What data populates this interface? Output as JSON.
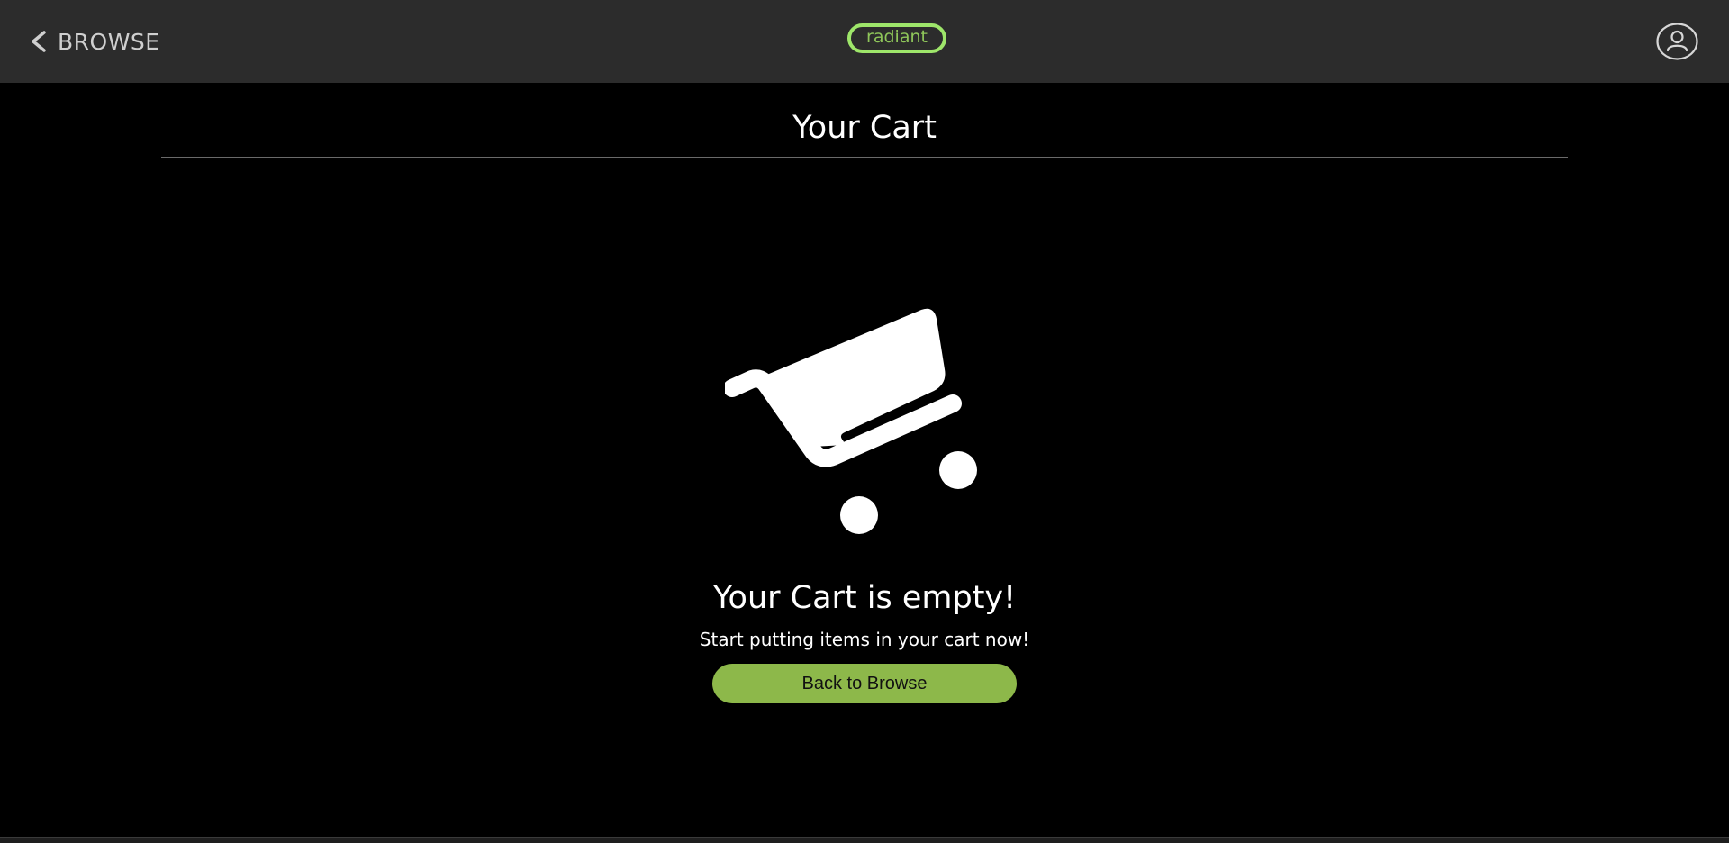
{
  "header": {
    "back_label": "BROWSE",
    "back_icon": "chevron-left-icon",
    "logo_text": "radiant",
    "profile_icon": "user-icon"
  },
  "colors": {
    "header_bg": "#2c2c2c",
    "page_bg": "#000000",
    "accent": "#9ee66a",
    "button_bg": "#8db84a"
  },
  "main": {
    "title": "Your Cart",
    "cart_icon": "shopping-cart-icon",
    "empty_heading": "Your Cart is empty!",
    "empty_message": "Start putting items in your cart now!",
    "browse_button_label": "Back to Browse"
  }
}
